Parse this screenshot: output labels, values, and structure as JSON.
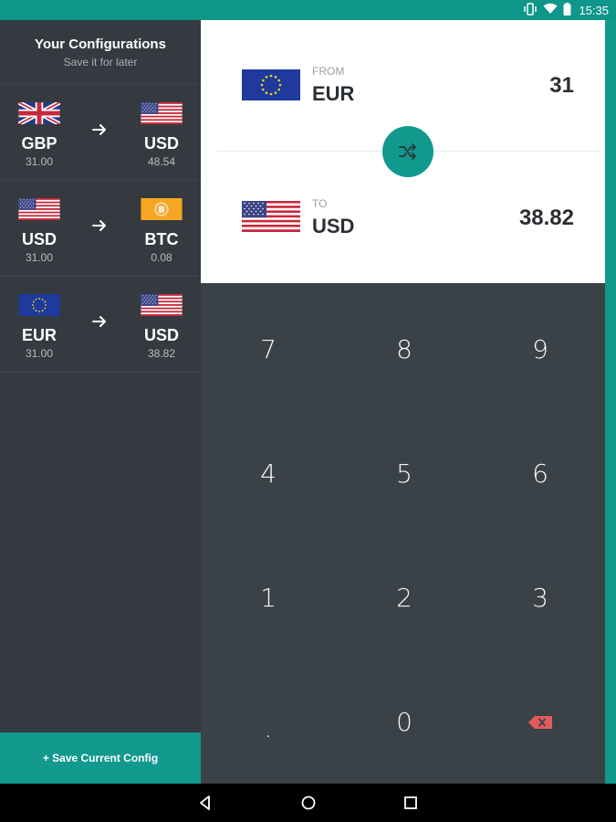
{
  "status_bar": {
    "time": "15:35",
    "icons": [
      "vibrate-icon",
      "wifi-icon",
      "battery-icon"
    ]
  },
  "sidebar": {
    "title": "Your Configurations",
    "subtitle": "Save it for later",
    "configs": [
      {
        "from_code": "GBP",
        "from_amount": "31.00",
        "from_flag": "uk-flag-icon",
        "to_code": "USD",
        "to_amount": "48.54",
        "to_flag": "us-flag-icon"
      },
      {
        "from_code": "USD",
        "from_amount": "31.00",
        "from_flag": "us-flag-icon",
        "to_code": "BTC",
        "to_amount": "0.08",
        "to_flag": "bitcoin-icon"
      },
      {
        "from_code": "EUR",
        "from_amount": "31.00",
        "from_flag": "eu-flag-icon",
        "to_code": "USD",
        "to_amount": "38.82",
        "to_flag": "us-flag-icon"
      }
    ],
    "save_label": "+ Save Current Config"
  },
  "converter": {
    "from": {
      "label": "FROM",
      "code": "EUR",
      "value": "31",
      "flag": "eu-flag-icon"
    },
    "to": {
      "label": "TO",
      "code": "USD",
      "value": "38.82",
      "flag": "us-flag-icon"
    },
    "swap_icon": "shuffle-icon"
  },
  "keypad": {
    "keys": [
      "7",
      "8",
      "9",
      "4",
      "5",
      "6",
      "1",
      "2",
      "3",
      ".",
      "0",
      "backspace"
    ]
  },
  "colors": {
    "accent": "#11998e",
    "sidebar_bg": "#343a3f",
    "keypad_bg": "#3a4147",
    "backspace": "#e05b5b"
  },
  "nav": {
    "icons": [
      "back-icon",
      "home-icon",
      "recents-icon"
    ]
  }
}
